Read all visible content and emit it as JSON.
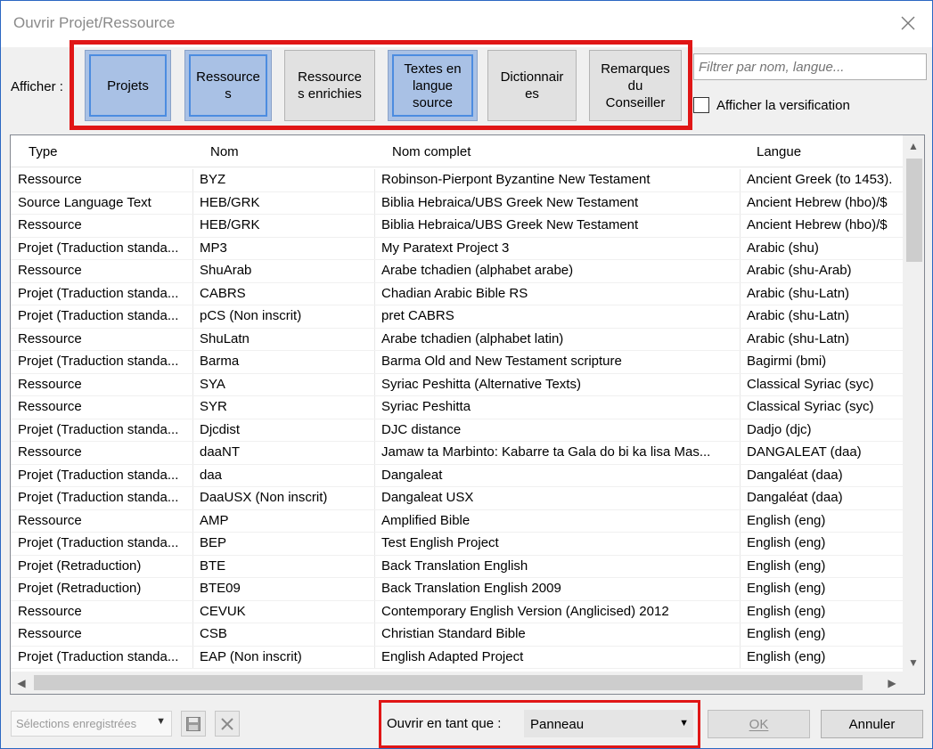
{
  "window": {
    "title": "Ouvrir Projet/Ressource",
    "close_icon": "close-icon"
  },
  "filter": {
    "label": "Afficher :",
    "buttons": [
      {
        "label": "Projets",
        "active": true
      },
      {
        "label": "Ressource\ns",
        "active": true
      },
      {
        "label": "Ressource\ns enrichies",
        "active": false
      },
      {
        "label": "Textes en\nlangue\nsource",
        "active": true
      },
      {
        "label": "Dictionnair\nes",
        "active": false
      },
      {
        "label": "Remarques\ndu\nConseiller",
        "active": false
      }
    ],
    "search_placeholder": "Filtrer par nom, langue...",
    "show_verification": "Afficher la versification"
  },
  "table": {
    "columns": [
      "Type",
      "Nom",
      "Nom complet",
      "Langue"
    ],
    "rows": [
      [
        "Ressource",
        "BYZ",
        "Robinson-Pierpont Byzantine New Testament",
        "Ancient Greek (to 1453)."
      ],
      [
        "Source Language Text",
        "HEB/GRK",
        "Biblia Hebraica/UBS Greek New Testament",
        "Ancient Hebrew (hbo)/$"
      ],
      [
        "Ressource",
        "HEB/GRK",
        "Biblia Hebraica/UBS Greek New Testament",
        "Ancient Hebrew (hbo)/$"
      ],
      [
        "Projet (Traduction standa...",
        "MP3",
        "My Paratext Project 3",
        "Arabic (shu)"
      ],
      [
        "Ressource",
        "ShuArab",
        "Arabe tchadien (alphabet arabe)",
        "Arabic (shu-Arab)"
      ],
      [
        "Projet (Traduction standa...",
        "CABRS",
        "Chadian Arabic Bible RS",
        "Arabic (shu-Latn)"
      ],
      [
        "Projet (Traduction standa...",
        "pCS (Non inscrit)",
        "pret CABRS",
        "Arabic (shu-Latn)"
      ],
      [
        "Ressource",
        "ShuLatn",
        "Arabe tchadien (alphabet latin)",
        "Arabic (shu-Latn)"
      ],
      [
        "Projet (Traduction standa...",
        "Barma",
        "Barma Old and New Testament scripture",
        "Bagirmi (bmi)"
      ],
      [
        "Ressource",
        "SYA",
        "Syriac Peshitta (Alternative Texts)",
        "Classical Syriac (syc)"
      ],
      [
        "Ressource",
        "SYR",
        "Syriac Peshitta",
        "Classical Syriac (syc)"
      ],
      [
        "Projet (Traduction standa...",
        "Djcdist",
        "DJC distance",
        "Dadjo (djc)"
      ],
      [
        "Ressource",
        "daaNT",
        "Jamaw ta Marbinto: Kabarre ta Gala do bi ka lisa Mas...",
        "DANGALEAT (daa)"
      ],
      [
        "Projet (Traduction standa...",
        "daa",
        "Dangaleat",
        "Dangaléat (daa)"
      ],
      [
        "Projet (Traduction standa...",
        "DaaUSX (Non inscrit)",
        "Dangaleat USX",
        "Dangaléat (daa)"
      ],
      [
        "Ressource",
        "AMP",
        "Amplified Bible",
        "English (eng)"
      ],
      [
        "Projet (Traduction standa...",
        "BEP",
        "Test English Project",
        "English (eng)"
      ],
      [
        "Projet (Retraduction)",
        "BTE",
        "Back Translation English",
        "English (eng)"
      ],
      [
        "Projet (Retraduction)",
        "BTE09",
        "Back Translation English 2009",
        "English (eng)"
      ],
      [
        "Ressource",
        "CEVUK",
        "Contemporary English Version (Anglicised) 2012",
        "English (eng)"
      ],
      [
        "Ressource",
        "CSB",
        "Christian Standard Bible",
        "English (eng)"
      ],
      [
        "Projet (Traduction standa...",
        "EAP (Non inscrit)",
        "English Adapted Project",
        "English (eng)"
      ]
    ]
  },
  "footer": {
    "saved_selections": "Sélections enregistrées",
    "open_as_label": "Ouvrir en tant que :",
    "open_as_value": "Panneau",
    "ok": "OK",
    "cancel": "Annuler"
  }
}
